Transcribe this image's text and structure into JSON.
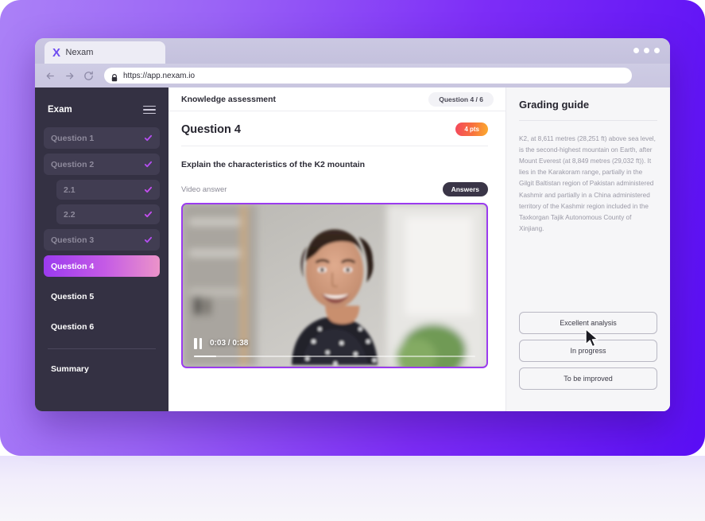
{
  "browser": {
    "tab": {
      "logo": "X",
      "title": "Nexam"
    },
    "url": "https://app.nexam.io",
    "nav": {
      "back": "back-arrow",
      "forward": "forward-arrow",
      "reload": "reload-icon"
    },
    "window_buttons": [
      "dot",
      "dot",
      "dot"
    ]
  },
  "sidebar": {
    "title": "Exam",
    "menu_icon": "hamburger-icon",
    "items": [
      {
        "label": "Question 1",
        "state": "done",
        "indent": 0
      },
      {
        "label": "Question 2",
        "state": "done",
        "indent": 0
      },
      {
        "label": "2.1",
        "state": "done",
        "indent": 1
      },
      {
        "label": "2.2",
        "state": "done",
        "indent": 1
      },
      {
        "label": "Question 3",
        "state": "done",
        "indent": 0
      },
      {
        "label": "Question 4",
        "state": "active",
        "indent": 0
      },
      {
        "label": "Question 5",
        "state": "todo",
        "indent": 0
      },
      {
        "label": "Question 6",
        "state": "todo",
        "indent": 0
      }
    ],
    "summary_label": "Summary"
  },
  "topbar": {
    "title": "Knowledge assessment",
    "progress_pill": "Question 4 / 6"
  },
  "question": {
    "title": "Question 4",
    "points_badge": "4 pts",
    "prompt": "Explain the characteristics of the K2 mountain",
    "video_label": "Video answer",
    "answers_badge": "Answers"
  },
  "video": {
    "current_time": "0:03",
    "duration": "0:38",
    "time_display": "0:03 / 0:38",
    "progress_percent": 8,
    "play_state": "paused",
    "control_icon": "pause-icon"
  },
  "grading": {
    "title": "Grading guide",
    "text": "K2, at 8,611 metres (28,251 ft) above sea level, is the second-highest mountain on Earth, after Mount Everest (at 8,849 metres (29,032 ft)). It lies in the Karakoram range, partially in the Gilgit Baltistan region of Pakistan administered Kashmir and partially in a China administered territory of the Kashmir region included in the Taxkorgan Tajik Autonomous County of Xinjiang.",
    "buttons": [
      {
        "label": "Excellent analysis"
      },
      {
        "label": "In progress"
      },
      {
        "label": "To be improved"
      }
    ]
  },
  "colors": {
    "brand_purple": "#6d4bf0",
    "accent_violet": "#9b3bef",
    "accent_pink": "#eb93c9",
    "points_orange": "#f7713f",
    "sidebar_bg": "#343143",
    "hero_from": "#ab81f7",
    "hero_to": "#5a0ef5"
  }
}
